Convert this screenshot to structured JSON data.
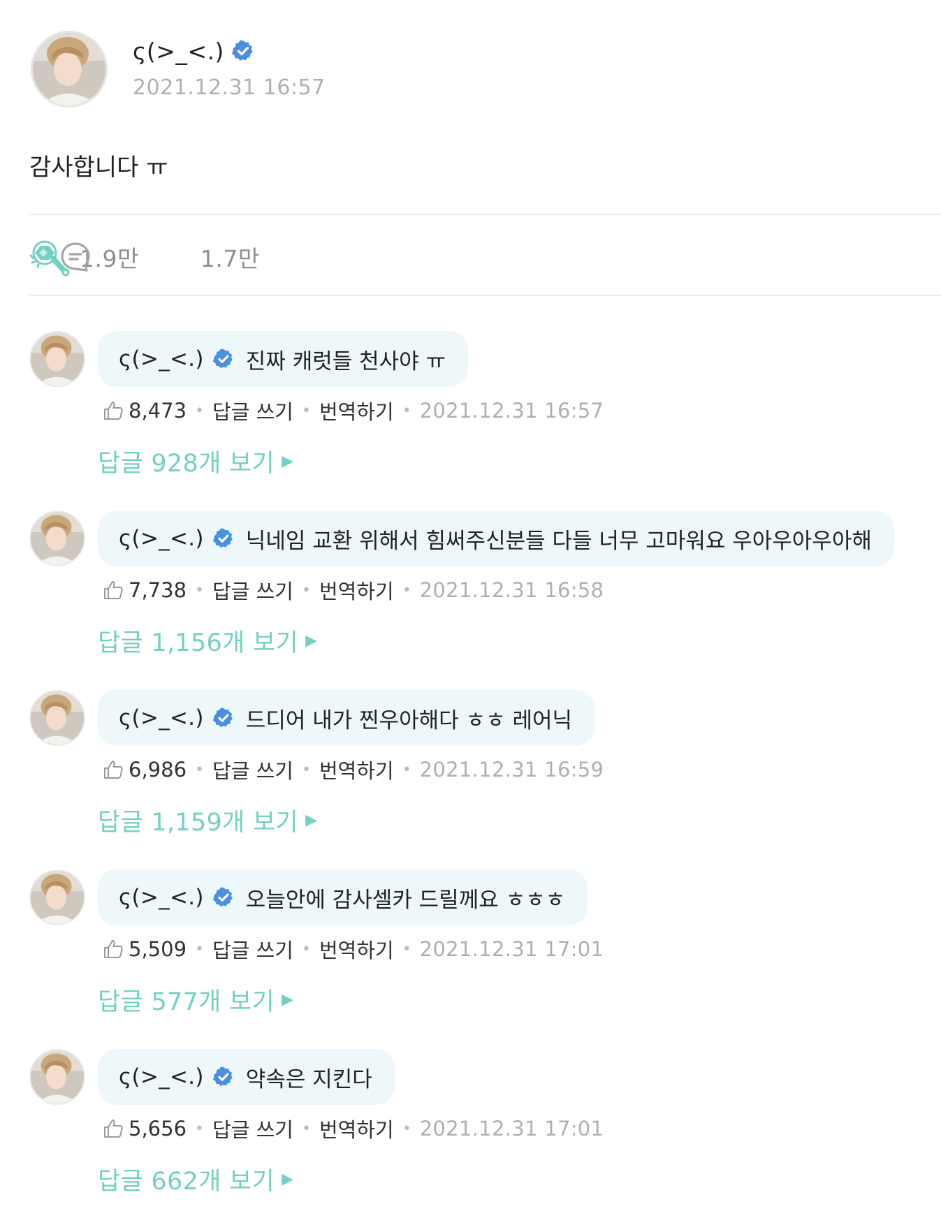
{
  "post": {
    "author": "ς(>_<.)",
    "timestamp": "2021.12.31 16:57",
    "body": "감사합니다 ㅠ",
    "likes": "1.9만",
    "comments_count": "1.7만",
    "icons": {
      "verified": "verified-badge-icon",
      "like": "light-stick-icon",
      "comment": "comment-bubble-icon"
    }
  },
  "comments": [
    {
      "author": "ς(>_<.)",
      "text": "진짜 캐럿들 천사야 ㅠ",
      "likes": "8,473",
      "reply_label": "답글 쓰기",
      "translate_label": "번역하기",
      "time": "2021.12.31 16:57",
      "replies_label": "답글 928개 보기"
    },
    {
      "author": "ς(>_<.)",
      "text": "닉네임 교환 위해서 힘써주신분들 다들 너무 고마워요 우아우아우아해",
      "likes": "7,738",
      "reply_label": "답글 쓰기",
      "translate_label": "번역하기",
      "time": "2021.12.31 16:58",
      "replies_label": "답글 1,156개 보기"
    },
    {
      "author": "ς(>_<.)",
      "text": "드디어 내가 찐우아해다 ㅎㅎ 레어닉",
      "likes": "6,986",
      "reply_label": "답글 쓰기",
      "translate_label": "번역하기",
      "time": "2021.12.31 16:59",
      "replies_label": "답글 1,159개 보기"
    },
    {
      "author": "ς(>_<.)",
      "text": "오늘안에 감사셀카 드릴께요 ㅎㅎㅎ",
      "likes": "5,509",
      "reply_label": "답글 쓰기",
      "translate_label": "번역하기",
      "time": "2021.12.31 17:01",
      "replies_label": "답글 577개 보기"
    },
    {
      "author": "ς(>_<.)",
      "text": "약속은 지킨다",
      "likes": "5,656",
      "reply_label": "답글 쓰기",
      "translate_label": "번역하기",
      "time": "2021.12.31 17:01",
      "replies_label": "답글 662개 보기"
    }
  ],
  "colors": {
    "accent": "#73d1c3",
    "verified": "#4a90e2",
    "bubble": "#eef8fb",
    "muted": "#b0b0b0"
  }
}
